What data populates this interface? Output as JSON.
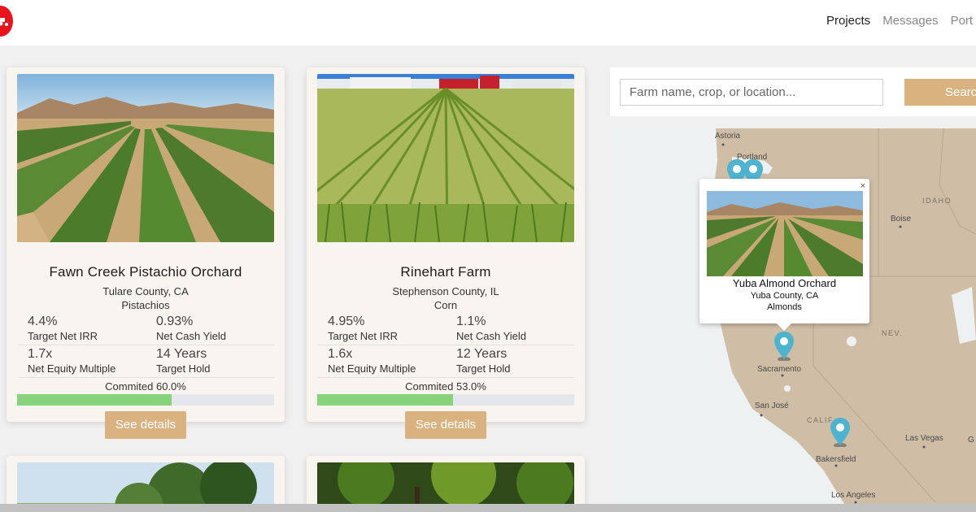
{
  "nav": {
    "items": [
      {
        "label": "Projects",
        "active": true
      },
      {
        "label": "Messages",
        "active": false
      },
      {
        "label": "Port",
        "active": false
      }
    ]
  },
  "projects": [
    {
      "title": "Fawn Creek Pistachio Orchard",
      "location": "Tulare County, CA",
      "crop": "Pistachios",
      "irr": "4.4%",
      "irr_label": "Target Net IRR",
      "yield": "0.93%",
      "yield_label": "Net Cash Yield",
      "multiple": "1.7x",
      "multiple_label": "Net Equity Multiple",
      "hold": "14 Years",
      "hold_label": "Target Hold",
      "committed_text": "Commited 60.0%",
      "committed": 0.6,
      "button": "See details"
    },
    {
      "title": "Rinehart Farm",
      "location": "Stephenson County, IL",
      "crop": "Corn",
      "irr": "4.95%",
      "irr_label": "Target Net IRR",
      "yield": "1.1%",
      "yield_label": "Net Cash Yield",
      "multiple": "1.6x",
      "multiple_label": "Net Equity Multiple",
      "hold": "12 Years",
      "hold_label": "Target Hold",
      "committed_text": "Commited 53.0%",
      "committed": 0.53,
      "button": "See details"
    }
  ],
  "search": {
    "placeholder": "Farm name, crop, or location...",
    "button": "Search"
  },
  "map": {
    "labels": {
      "astoria": "Astoria",
      "portland": "Portland",
      "idaho": "IDAHO",
      "boise": "Boise",
      "nev": "NEV.",
      "sacramento": "Sacramento",
      "sanjose": "San José",
      "calif": "CALIF",
      "lasvegas": "Las Vegas",
      "bakersfield": "Bakersfield",
      "losangeles": "Los Angeles",
      "g": "G"
    },
    "popup": {
      "close": "×",
      "title": "Yuba Almond Orchard",
      "location": "Yuba County, CA",
      "crop": "Almonds"
    }
  },
  "colors": {
    "accent": "#d9b280",
    "progress": "#87d37c",
    "pin": "#4eb3cf",
    "land": "#cfbda6",
    "brand": "#e8141c"
  }
}
